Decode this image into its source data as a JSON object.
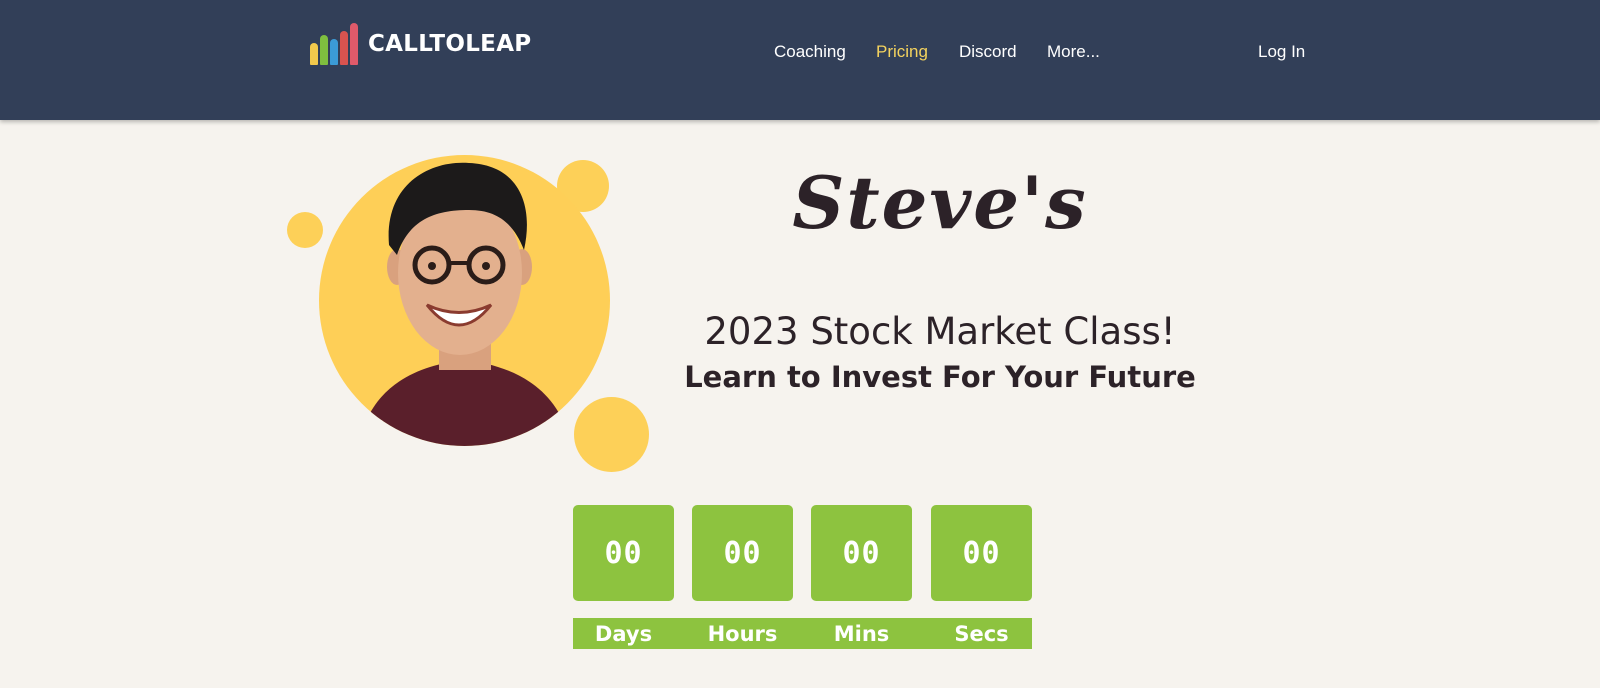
{
  "header": {
    "logo_text": "CALLTOLEAP",
    "logo_bar_colors": [
      "#f2c94c",
      "#7fbf3f",
      "#3b9bd6",
      "#d9534f",
      "#e05a6a"
    ],
    "nav": [
      {
        "label": "Coaching",
        "active": false
      },
      {
        "label": "Pricing",
        "active": true
      },
      {
        "label": "Discord",
        "active": false
      },
      {
        "label": "More...",
        "active": false
      }
    ],
    "login_label": "Log In"
  },
  "hero": {
    "script_title": "Steve's",
    "class_title": "2023 Stock Market Class!",
    "class_subtitle": "Learn to Invest For Your Future",
    "photo_icon": "person-photo"
  },
  "countdown": {
    "units": [
      {
        "value": "00",
        "label": "Days"
      },
      {
        "value": "00",
        "label": "Hours"
      },
      {
        "value": "00",
        "label": "Mins"
      },
      {
        "value": "00",
        "label": "Secs"
      }
    ]
  },
  "colors": {
    "header_bg": "#323f58",
    "page_bg": "#f6f3ee",
    "accent_yellow": "#fdd058",
    "active_nav": "#f4d35e",
    "countdown_green": "#8dc33f",
    "text_dark": "#2c2228"
  }
}
